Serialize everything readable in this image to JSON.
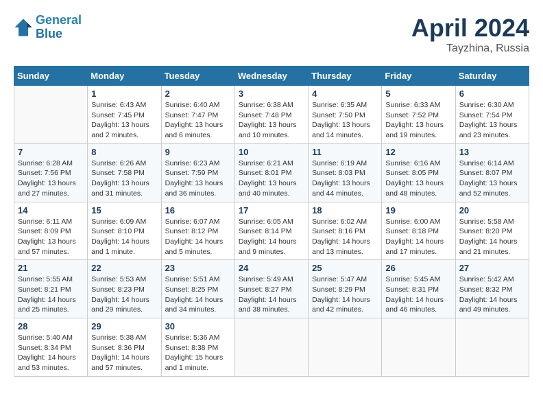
{
  "header": {
    "logo_line1": "General",
    "logo_line2": "Blue",
    "month": "April 2024",
    "location": "Tayzhina, Russia"
  },
  "days_of_week": [
    "Sunday",
    "Monday",
    "Tuesday",
    "Wednesday",
    "Thursday",
    "Friday",
    "Saturday"
  ],
  "weeks": [
    [
      {
        "num": "",
        "info": ""
      },
      {
        "num": "1",
        "info": "Sunrise: 6:43 AM\nSunset: 7:45 PM\nDaylight: 13 hours\nand 2 minutes."
      },
      {
        "num": "2",
        "info": "Sunrise: 6:40 AM\nSunset: 7:47 PM\nDaylight: 13 hours\nand 6 minutes."
      },
      {
        "num": "3",
        "info": "Sunrise: 6:38 AM\nSunset: 7:48 PM\nDaylight: 13 hours\nand 10 minutes."
      },
      {
        "num": "4",
        "info": "Sunrise: 6:35 AM\nSunset: 7:50 PM\nDaylight: 13 hours\nand 14 minutes."
      },
      {
        "num": "5",
        "info": "Sunrise: 6:33 AM\nSunset: 7:52 PM\nDaylight: 13 hours\nand 19 minutes."
      },
      {
        "num": "6",
        "info": "Sunrise: 6:30 AM\nSunset: 7:54 PM\nDaylight: 13 hours\nand 23 minutes."
      }
    ],
    [
      {
        "num": "7",
        "info": "Sunrise: 6:28 AM\nSunset: 7:56 PM\nDaylight: 13 hours\nand 27 minutes."
      },
      {
        "num": "8",
        "info": "Sunrise: 6:26 AM\nSunset: 7:58 PM\nDaylight: 13 hours\nand 31 minutes."
      },
      {
        "num": "9",
        "info": "Sunrise: 6:23 AM\nSunset: 7:59 PM\nDaylight: 13 hours\nand 36 minutes."
      },
      {
        "num": "10",
        "info": "Sunrise: 6:21 AM\nSunset: 8:01 PM\nDaylight: 13 hours\nand 40 minutes."
      },
      {
        "num": "11",
        "info": "Sunrise: 6:19 AM\nSunset: 8:03 PM\nDaylight: 13 hours\nand 44 minutes."
      },
      {
        "num": "12",
        "info": "Sunrise: 6:16 AM\nSunset: 8:05 PM\nDaylight: 13 hours\nand 48 minutes."
      },
      {
        "num": "13",
        "info": "Sunrise: 6:14 AM\nSunset: 8:07 PM\nDaylight: 13 hours\nand 52 minutes."
      }
    ],
    [
      {
        "num": "14",
        "info": "Sunrise: 6:11 AM\nSunset: 8:09 PM\nDaylight: 13 hours\nand 57 minutes."
      },
      {
        "num": "15",
        "info": "Sunrise: 6:09 AM\nSunset: 8:10 PM\nDaylight: 14 hours\nand 1 minute."
      },
      {
        "num": "16",
        "info": "Sunrise: 6:07 AM\nSunset: 8:12 PM\nDaylight: 14 hours\nand 5 minutes."
      },
      {
        "num": "17",
        "info": "Sunrise: 6:05 AM\nSunset: 8:14 PM\nDaylight: 14 hours\nand 9 minutes."
      },
      {
        "num": "18",
        "info": "Sunrise: 6:02 AM\nSunset: 8:16 PM\nDaylight: 14 hours\nand 13 minutes."
      },
      {
        "num": "19",
        "info": "Sunrise: 6:00 AM\nSunset: 8:18 PM\nDaylight: 14 hours\nand 17 minutes."
      },
      {
        "num": "20",
        "info": "Sunrise: 5:58 AM\nSunset: 8:20 PM\nDaylight: 14 hours\nand 21 minutes."
      }
    ],
    [
      {
        "num": "21",
        "info": "Sunrise: 5:55 AM\nSunset: 8:21 PM\nDaylight: 14 hours\nand 25 minutes."
      },
      {
        "num": "22",
        "info": "Sunrise: 5:53 AM\nSunset: 8:23 PM\nDaylight: 14 hours\nand 29 minutes."
      },
      {
        "num": "23",
        "info": "Sunrise: 5:51 AM\nSunset: 8:25 PM\nDaylight: 14 hours\nand 34 minutes."
      },
      {
        "num": "24",
        "info": "Sunrise: 5:49 AM\nSunset: 8:27 PM\nDaylight: 14 hours\nand 38 minutes."
      },
      {
        "num": "25",
        "info": "Sunrise: 5:47 AM\nSunset: 8:29 PM\nDaylight: 14 hours\nand 42 minutes."
      },
      {
        "num": "26",
        "info": "Sunrise: 5:45 AM\nSunset: 8:31 PM\nDaylight: 14 hours\nand 46 minutes."
      },
      {
        "num": "27",
        "info": "Sunrise: 5:42 AM\nSunset: 8:32 PM\nDaylight: 14 hours\nand 49 minutes."
      }
    ],
    [
      {
        "num": "28",
        "info": "Sunrise: 5:40 AM\nSunset: 8:34 PM\nDaylight: 14 hours\nand 53 minutes."
      },
      {
        "num": "29",
        "info": "Sunrise: 5:38 AM\nSunset: 8:36 PM\nDaylight: 14 hours\nand 57 minutes."
      },
      {
        "num": "30",
        "info": "Sunrise: 5:36 AM\nSunset: 8:38 PM\nDaylight: 15 hours\nand 1 minute."
      },
      {
        "num": "",
        "info": ""
      },
      {
        "num": "",
        "info": ""
      },
      {
        "num": "",
        "info": ""
      },
      {
        "num": "",
        "info": ""
      }
    ]
  ]
}
